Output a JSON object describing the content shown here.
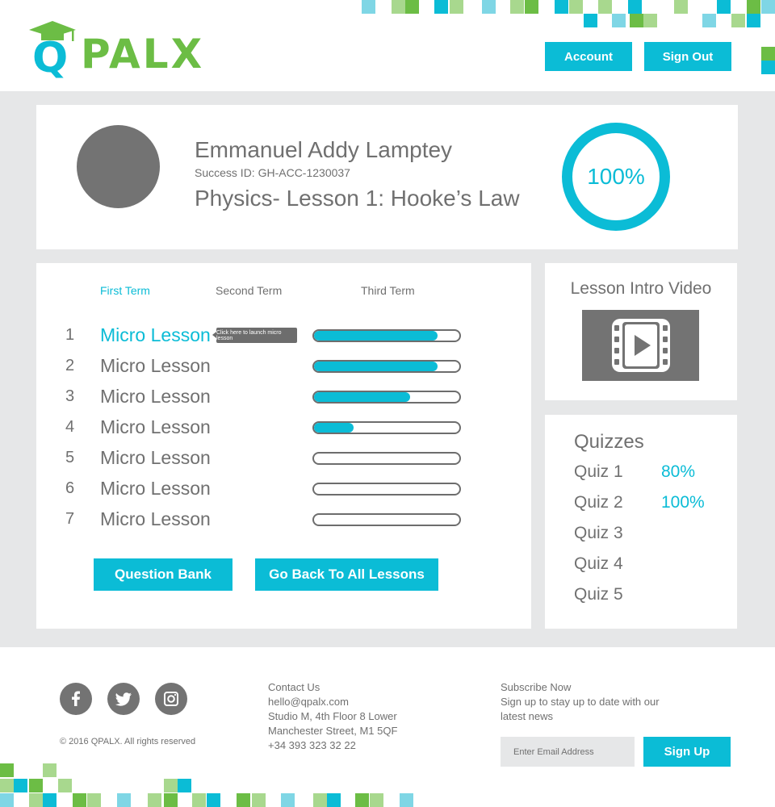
{
  "header": {
    "logo_text": "PALX",
    "logo_q": "Q",
    "account_label": "Account",
    "signout_label": "Sign Out"
  },
  "profile": {
    "name": "Emmanuel Addy Lamptey",
    "success_id": "Success ID: GH-ACC-1230037",
    "lesson_title": "Physics- Lesson 1: Hooke’s Law",
    "progress": "100%"
  },
  "terms": [
    {
      "label": "First Term"
    },
    {
      "label": "Second Term"
    },
    {
      "label": "Third Term"
    }
  ],
  "lessons": [
    {
      "num": "1",
      "label": "Micro Lesson",
      "progress": 0.85
    },
    {
      "num": "2",
      "label": "Micro Lesson",
      "progress": 0.85
    },
    {
      "num": "3",
      "label": "Micro Lesson",
      "progress": 0.66
    },
    {
      "num": "4",
      "label": "Micro Lesson",
      "progress": 0.27
    },
    {
      "num": "5",
      "label": "Micro Lesson",
      "progress": 0
    },
    {
      "num": "6",
      "label": "Micro Lesson",
      "progress": 0
    },
    {
      "num": "7",
      "label": "Micro Lesson",
      "progress": 0
    }
  ],
  "tooltip": "Click here to launch micro lesson",
  "actions": {
    "question_bank": "Question Bank",
    "go_back": "Go Back To All Lessons"
  },
  "video": {
    "title": "Lesson Intro Video",
    "icon": "video-play-icon"
  },
  "quizzes": {
    "title": "Quizzes",
    "items": [
      {
        "label": "Quiz 1",
        "score": "80%"
      },
      {
        "label": "Quiz 2",
        "score": "100%"
      },
      {
        "label": "Quiz 3",
        "score": ""
      },
      {
        "label": "Quiz 4",
        "score": ""
      },
      {
        "label": "Quiz 5",
        "score": ""
      }
    ]
  },
  "footer": {
    "social_icons": [
      "facebook-icon",
      "twitter-icon",
      "instagram-icon"
    ],
    "copyright": "© 2016 QPALX. All rights reserved",
    "contact_heading": "Contact Us",
    "contact_email": "hello@qpalx.com",
    "contact_address_1": "Studio M, 4th Floor 8 Lower",
    "contact_address_2": "Manchester Street, M1 5QF",
    "contact_phone": "+34 393 323 32 22",
    "subscribe_heading": "Subscribe Now",
    "subscribe_text_1": "Sign up to stay up to date with our",
    "subscribe_text_2": "latest news",
    "email_placeholder": "Enter Email Address",
    "signup_label": "Sign Up"
  },
  "colors": {
    "accent": "#0bbcd6",
    "brand_green": "#6cbd45",
    "light_green": "#a8d88e",
    "light_blue": "#7fd6e5",
    "grey": "#737373",
    "background": "#e6e7e8"
  }
}
